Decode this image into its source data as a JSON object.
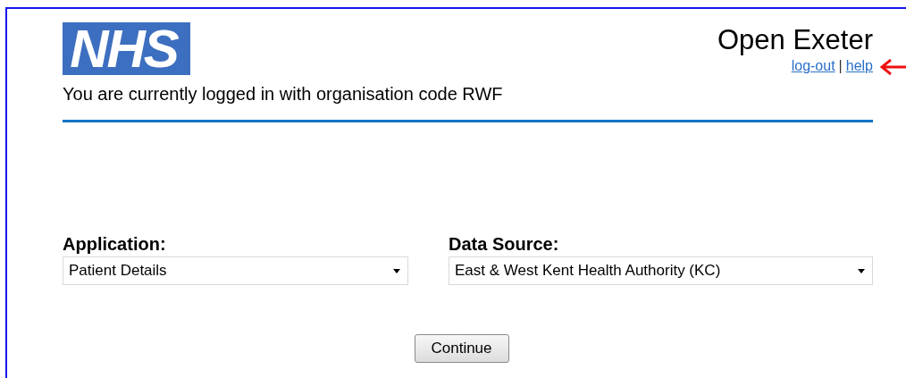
{
  "logo": {
    "text": "NHS"
  },
  "header": {
    "title": "Open Exeter",
    "links": [
      "log-out",
      "help"
    ],
    "separator": "|"
  },
  "login_message": "You are currently logged in with organisation code RWF",
  "fields": [
    {
      "label": "Application:",
      "value": "Patient Details"
    },
    {
      "label": "Data Source:",
      "value": "East & West Kent Health Authority (KC)"
    }
  ],
  "buttons": [
    "Continue"
  ]
}
